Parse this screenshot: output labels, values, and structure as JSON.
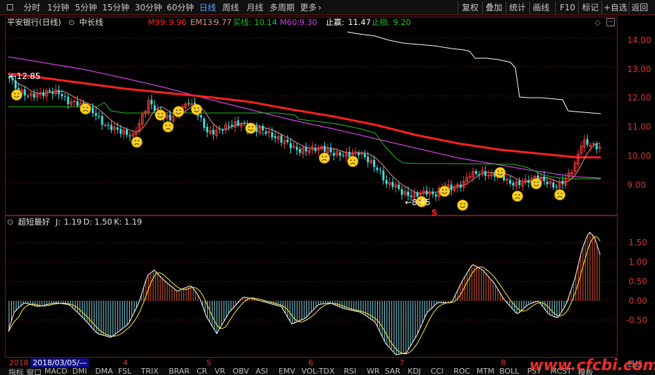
{
  "toolbar": {
    "left_items": [
      "分时",
      "1分钟",
      "5分钟",
      "15分钟",
      "30分钟",
      "60分钟",
      "日线",
      "周线",
      "月线",
      "多周期",
      "更多"
    ],
    "active_item": "日线",
    "right_items": [
      "复权",
      "叠加",
      "统计",
      "画线",
      "F10",
      "标记",
      "+自选",
      "返回"
    ]
  },
  "main_header": {
    "stock": "平安银行(日线)",
    "indicator_name": "中长线",
    "m99_label": "M99:",
    "m99_value": "9.96",
    "em13_label": "EM13:",
    "em13_value": "9.77",
    "buy_label": "买线:",
    "buy_value": "10.14",
    "m60_label": "M60:",
    "m60_value": "9.30",
    "tp_label": "止赢:",
    "tp_value": "11.47",
    "sl_label": "止损:",
    "sl_value": "9.20"
  },
  "sub_header": {
    "name": "超短最好",
    "j_label": "J:",
    "j_value": "1.19",
    "d_label": "D:",
    "d_value": "1.50",
    "k_label": "K:",
    "k_value": "1.19"
  },
  "annotations": {
    "high_label": "12.85",
    "low_label": "8.45",
    "signal_char": "S"
  },
  "price_axis": [
    "14.00",
    "13.00",
    "12.00",
    "11.00",
    "10.00",
    "9.00"
  ],
  "osc_axis": [
    "1.50",
    "1.00",
    "0.50",
    "0.00",
    "-0.50"
  ],
  "dates": {
    "year": "2018",
    "cursor_date": "2018/03/05/—",
    "months": [
      "4",
      "5",
      "6",
      "7",
      "8"
    ]
  },
  "period_badge": "日线",
  "bottom_tabs": [
    "指标",
    "窗口",
    "MACD",
    "DMI",
    "DMA",
    "FSL",
    "TRIX",
    "BRAR",
    "CR",
    "VR",
    "OBV",
    "ASI",
    "EMV",
    "VOL-TDX",
    "RSI",
    "WR",
    "SAR",
    "KDJ",
    "CCI",
    "ROC",
    "MTM",
    "BOLL",
    "PSY",
    "MCST",
    "模板"
  ],
  "watermark": "www.cfcbi.com",
  "colors": {
    "rise": "#ff3c3c",
    "fall": "#3fe0e0",
    "m99": "#ff2020",
    "em13": "#e89090",
    "buy_line": "#22c022",
    "m60": "#d040e0",
    "stop_line": "#ffffff",
    "k_line": "#ffffff",
    "d_line": "#ffee33",
    "border": "#7a1a1a"
  }
}
